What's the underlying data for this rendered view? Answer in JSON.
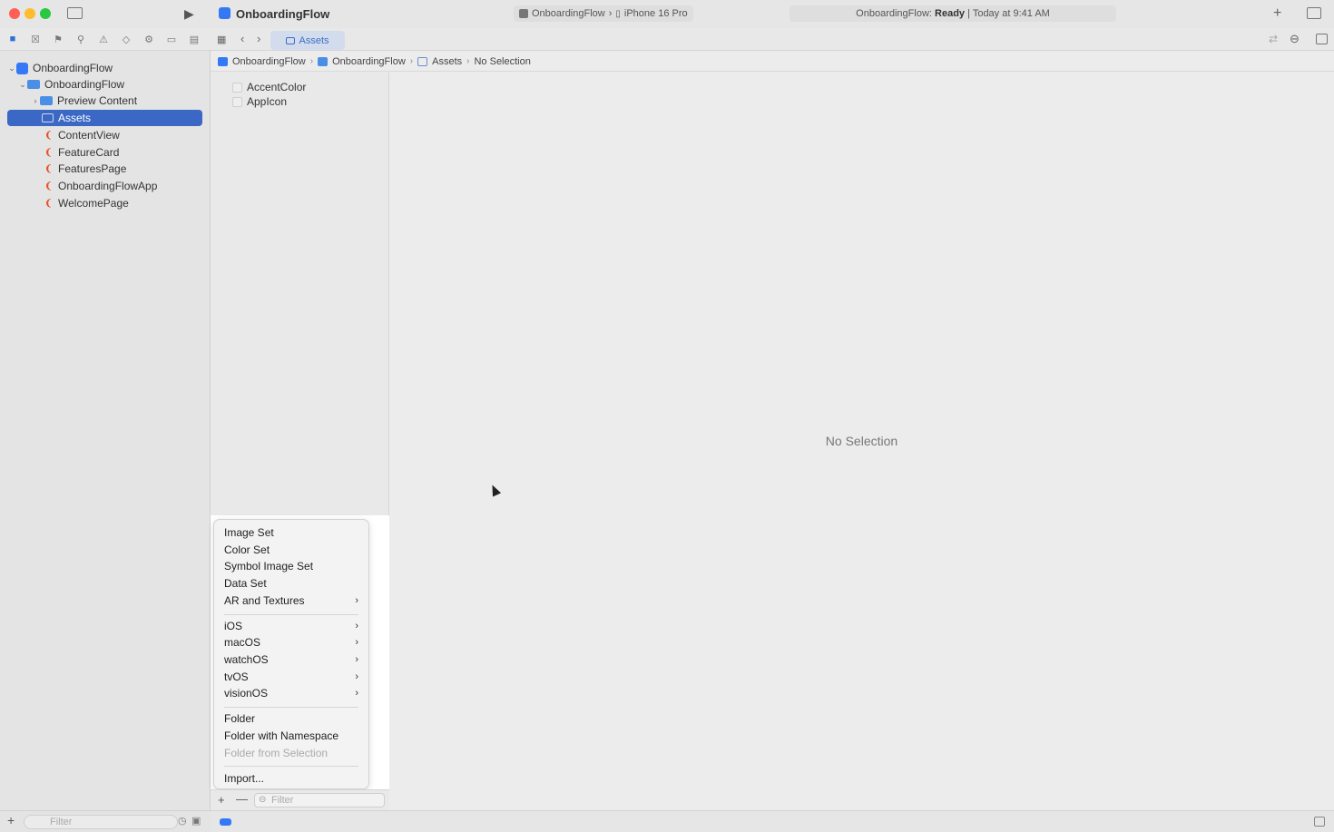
{
  "window": {
    "title": "OnboardingFlow",
    "scheme_project": "OnboardingFlow",
    "scheme_device": "iPhone 16 Pro",
    "status_project": "OnboardingFlow:",
    "status_state": "Ready",
    "status_time": "| Today at 9:41 AM"
  },
  "editor_tab": {
    "label": "Assets"
  },
  "breadcrumb": {
    "items": [
      "OnboardingFlow",
      "OnboardingFlow",
      "Assets",
      "No Selection"
    ]
  },
  "sidebar": {
    "root": "OnboardingFlow",
    "group": "OnboardingFlow",
    "preview_folder": "Preview Content",
    "items": [
      "Assets",
      "ContentView",
      "FeatureCard",
      "FeaturesPage",
      "OnboardingFlowApp",
      "WelcomePage"
    ],
    "filter_placeholder": "Filter"
  },
  "assets": {
    "items": [
      "AccentColor",
      "AppIcon"
    ],
    "filter_placeholder": "Filter"
  },
  "editor": {
    "empty_label": "No Selection"
  },
  "menu": {
    "group1": [
      {
        "label": "Image Set",
        "submenu": false
      },
      {
        "label": "Color Set",
        "submenu": false
      },
      {
        "label": "Symbol Image Set",
        "submenu": false
      },
      {
        "label": "Data Set",
        "submenu": false
      },
      {
        "label": "AR and Textures",
        "submenu": true
      }
    ],
    "group2": [
      {
        "label": "iOS",
        "submenu": true
      },
      {
        "label": "macOS",
        "submenu": true
      },
      {
        "label": "watchOS",
        "submenu": true
      },
      {
        "label": "tvOS",
        "submenu": true
      },
      {
        "label": "visionOS",
        "submenu": true
      }
    ],
    "group3": [
      {
        "label": "Folder",
        "submenu": false
      },
      {
        "label": "Folder with Namespace",
        "submenu": false
      },
      {
        "label": "Folder from Selection",
        "submenu": false,
        "disabled": true
      }
    ],
    "group4": [
      {
        "label": "Import...",
        "submenu": false
      }
    ]
  },
  "colors": {
    "accent": "#3b68c4",
    "swift_icon": "#e8502c"
  }
}
